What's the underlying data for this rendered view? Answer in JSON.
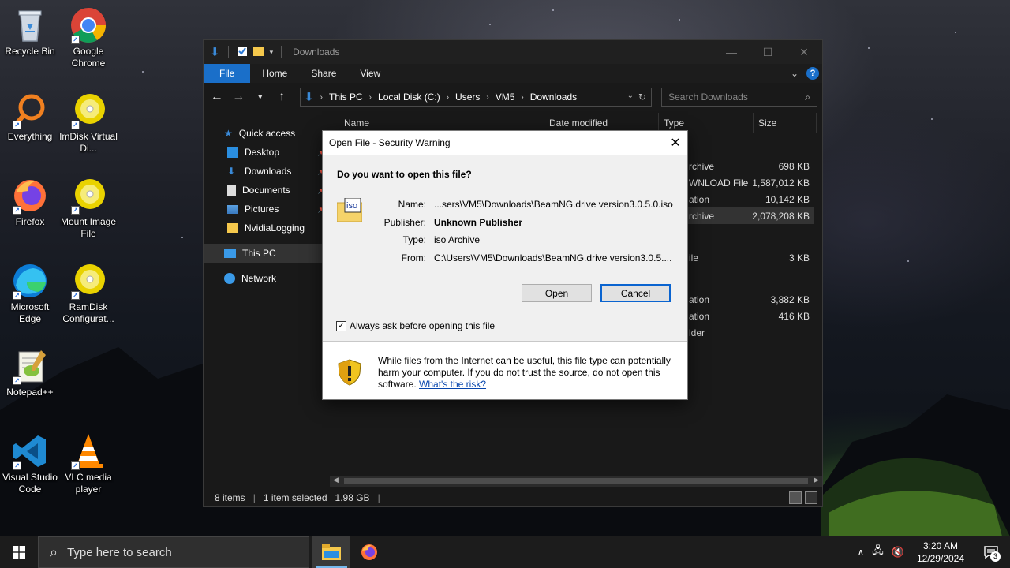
{
  "desktop": {
    "icons": [
      {
        "label": "Recycle Bin",
        "icon": "recycle-bin-icon"
      },
      {
        "label": "Google Chrome",
        "icon": "chrome-icon"
      },
      {
        "label": "Everything",
        "icon": "everything-icon"
      },
      {
        "label": "ImDisk Virtual Di...",
        "icon": "imdisk-icon"
      },
      {
        "label": "Firefox",
        "icon": "firefox-icon"
      },
      {
        "label": "Mount Image File",
        "icon": "mount-image-icon"
      },
      {
        "label": "Microsoft Edge",
        "icon": "edge-icon"
      },
      {
        "label": "RamDisk Configurat...",
        "icon": "ramdisk-icon"
      },
      {
        "label": "Notepad++",
        "icon": "notepadpp-icon"
      },
      {
        "label": "Visual Studio Code",
        "icon": "vscode-icon"
      },
      {
        "label": "VLC media player",
        "icon": "vlc-icon"
      }
    ]
  },
  "explorer": {
    "title": "Downloads",
    "ribbon_tabs": [
      "File",
      "Home",
      "Share",
      "View"
    ],
    "breadcrumb": [
      "This PC",
      "Local Disk (C:)",
      "Users",
      "VM5",
      "Downloads"
    ],
    "search_placeholder": "Search Downloads",
    "nav": {
      "quick_access": "Quick access",
      "items": [
        "Desktop",
        "Downloads",
        "Documents",
        "Pictures",
        "NvidiaLogging"
      ],
      "this_pc": "This PC",
      "network": "Network"
    },
    "columns": [
      "Name",
      "Date modified",
      "Type",
      "Size"
    ],
    "rows": [
      {
        "type": "rchive",
        "size": "698 KB"
      },
      {
        "type": "WNLOAD File",
        "size": "1,587,012 KB"
      },
      {
        "type": "ation",
        "size": "10,142 KB"
      },
      {
        "type": "rchive",
        "size": "2,078,208 KB"
      },
      {
        "type": "ile",
        "size": "3 KB"
      },
      {
        "type": "ation",
        "size": "3,882 KB"
      },
      {
        "type": "ation",
        "size": "416 KB"
      },
      {
        "type": "lder",
        "size": ""
      }
    ],
    "status": {
      "items": "8 items",
      "selected": "1 item selected",
      "size": "1.98 GB"
    }
  },
  "dialog": {
    "title": "Open File - Security Warning",
    "question": "Do you want to open this file?",
    "name_label": "Name:",
    "name_value": "...sers\\VM5\\Downloads\\BeamNG.drive version3.0.5.0.iso",
    "publisher_label": "Publisher:",
    "publisher_value": "Unknown Publisher",
    "type_label": "Type:",
    "type_value": "iso Archive",
    "from_label": "From:",
    "from_value": "C:\\Users\\VM5\\Downloads\\BeamNG.drive version3.0.5....",
    "open_button": "Open",
    "cancel_button": "Cancel",
    "checkbox_label": "Always ask before opening this file",
    "checkbox_checked": true,
    "warning_text": "While files from the Internet can be useful, this file type can potentially harm your computer. If you do not trust the source, do not open this software.",
    "risk_link": "What's the risk?",
    "file_icon_text": "iso"
  },
  "taskbar": {
    "search_placeholder": "Type here to search",
    "time": "3:20 AM",
    "date": "12/29/2024",
    "notification_count": "3"
  },
  "colors": {
    "accent": "#1a6fc9",
    "explorer_bg": "#191919",
    "dialog_bg": "#f0f0f0",
    "taskbar_bg": "#1c1c1c"
  }
}
